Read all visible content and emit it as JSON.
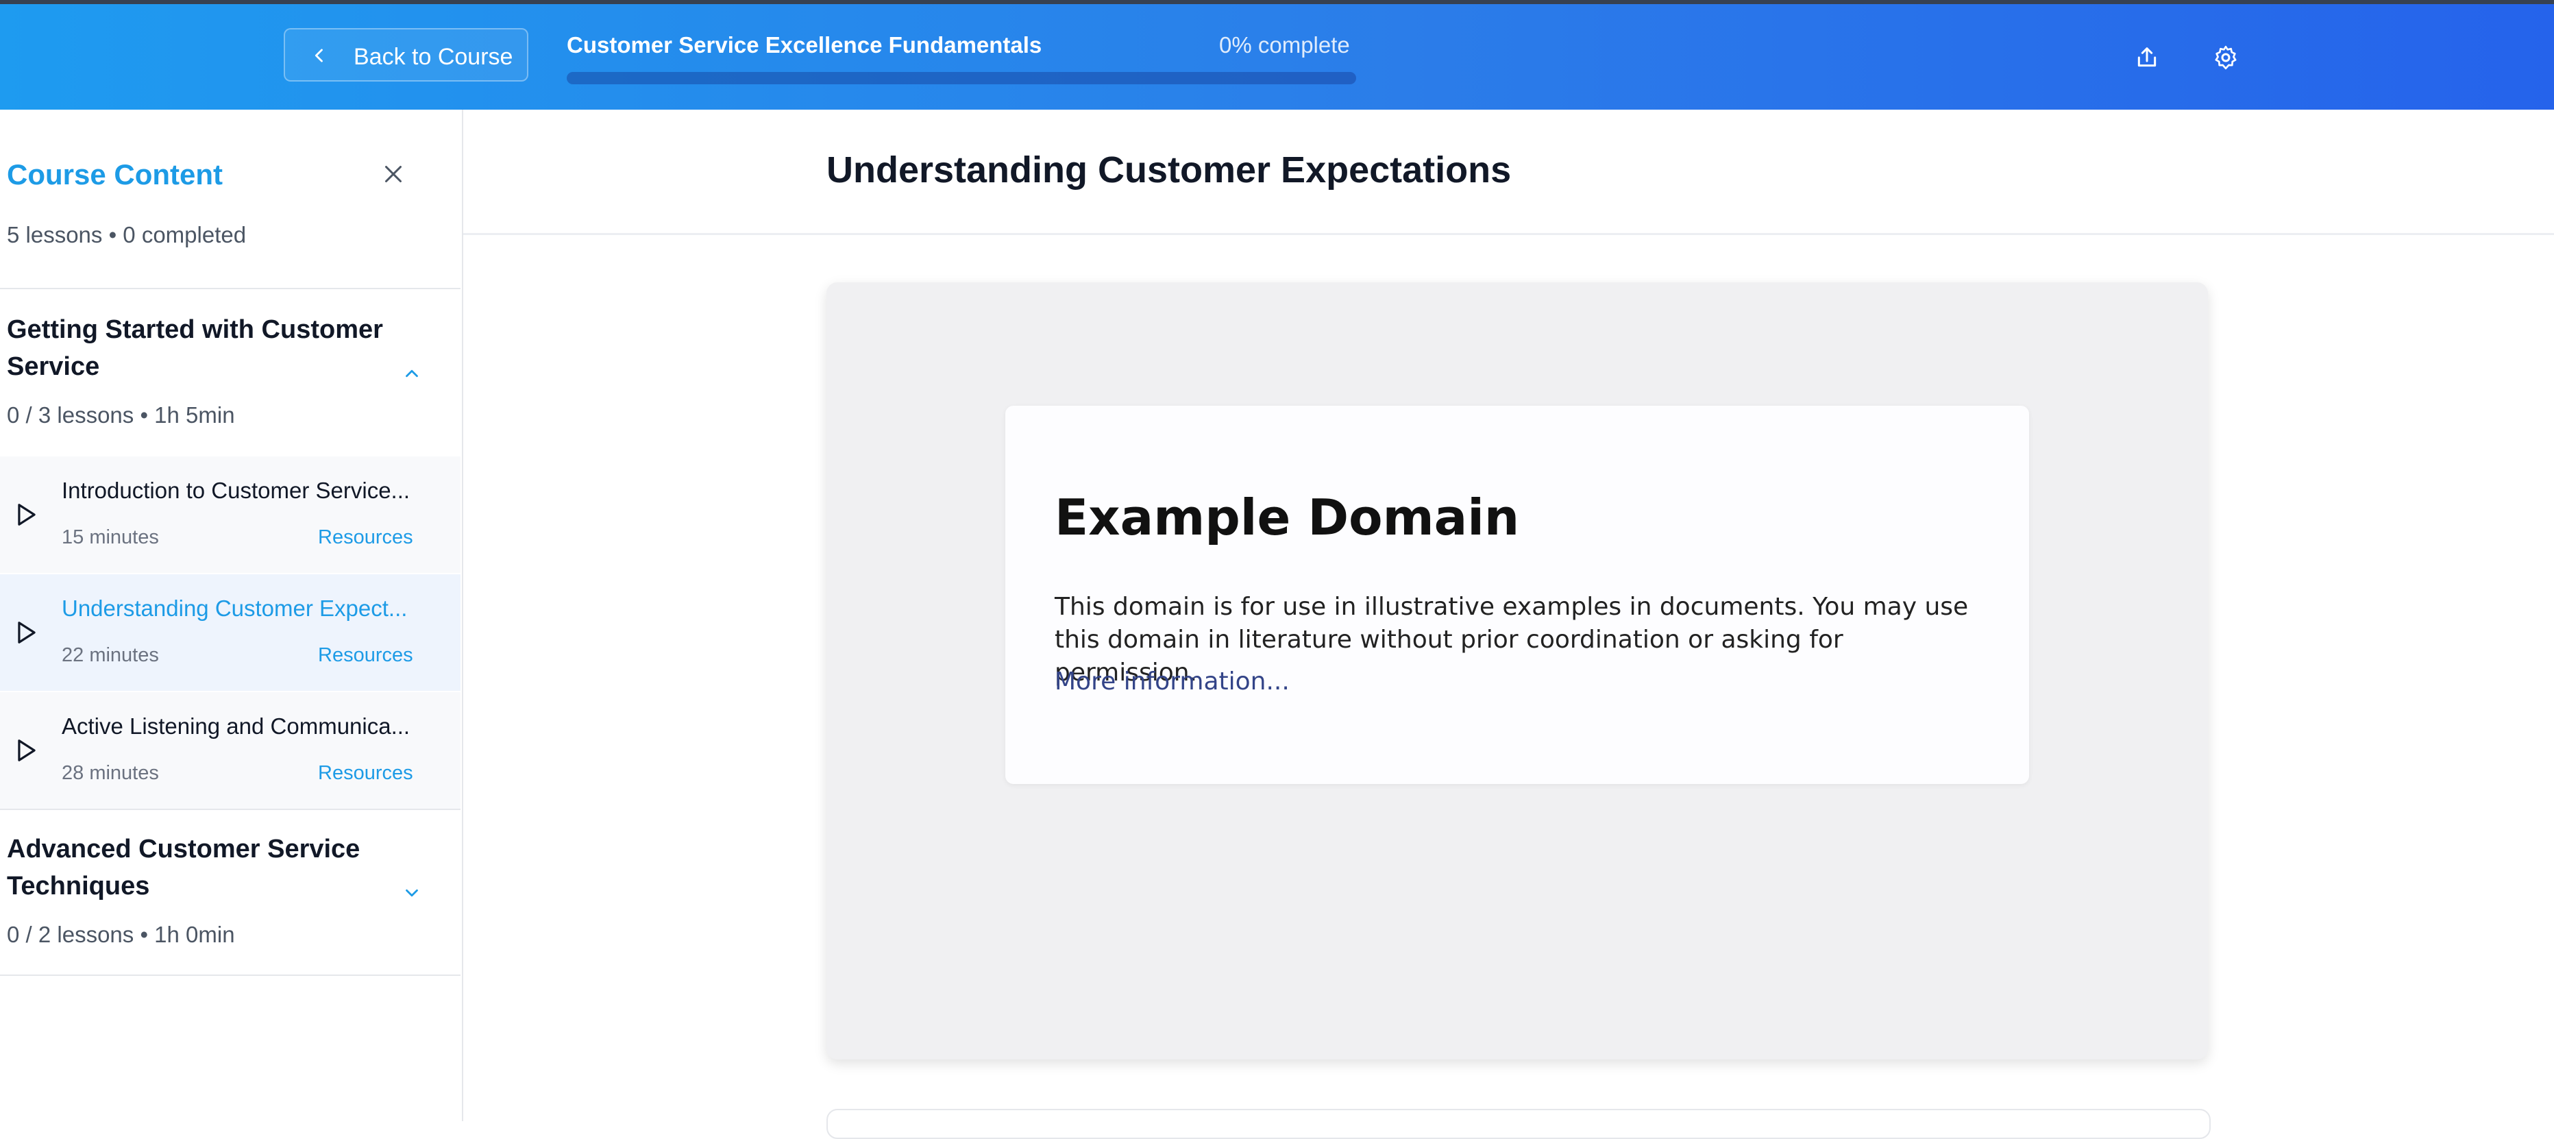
{
  "header": {
    "back_label": "Back to Course",
    "course_title": "Customer Service Excellence Fundamentals",
    "progress_text": "0% complete",
    "progress_fraction": 0,
    "share_icon": "share-icon",
    "settings_icon": "gear-icon"
  },
  "sidebar": {
    "title": "Course Content",
    "summary": "5 lessons • 0 completed",
    "sections": [
      {
        "title": "Getting Started with Customer Service",
        "meta": "0 / 3 lessons • 1h 5min",
        "expanded": true,
        "lessons": [
          {
            "title": "Introduction to Customer Service...",
            "duration": "15 minutes",
            "resources": "Resources",
            "active": false
          },
          {
            "title": "Understanding Customer Expect...",
            "duration": "22 minutes",
            "resources": "Resources",
            "active": true
          },
          {
            "title": "Active Listening and Communica...",
            "duration": "28 minutes",
            "resources": "Resources",
            "active": false
          }
        ]
      },
      {
        "title": "Advanced Customer Service Techniques",
        "meta": "0 / 2 lessons • 1h 0min",
        "expanded": false,
        "lessons": []
      }
    ]
  },
  "main": {
    "lesson_title": "Understanding Customer Expectations",
    "embed": {
      "heading": "Example Domain",
      "body": "This domain is for use in illustrative examples in documents. You may use this domain in literature without prior coordination or asking for permission.",
      "link": "More information..."
    }
  },
  "colors": {
    "accent": "#1d9be6",
    "header_start": "#1e9bf0",
    "header_end": "#2563eb"
  }
}
